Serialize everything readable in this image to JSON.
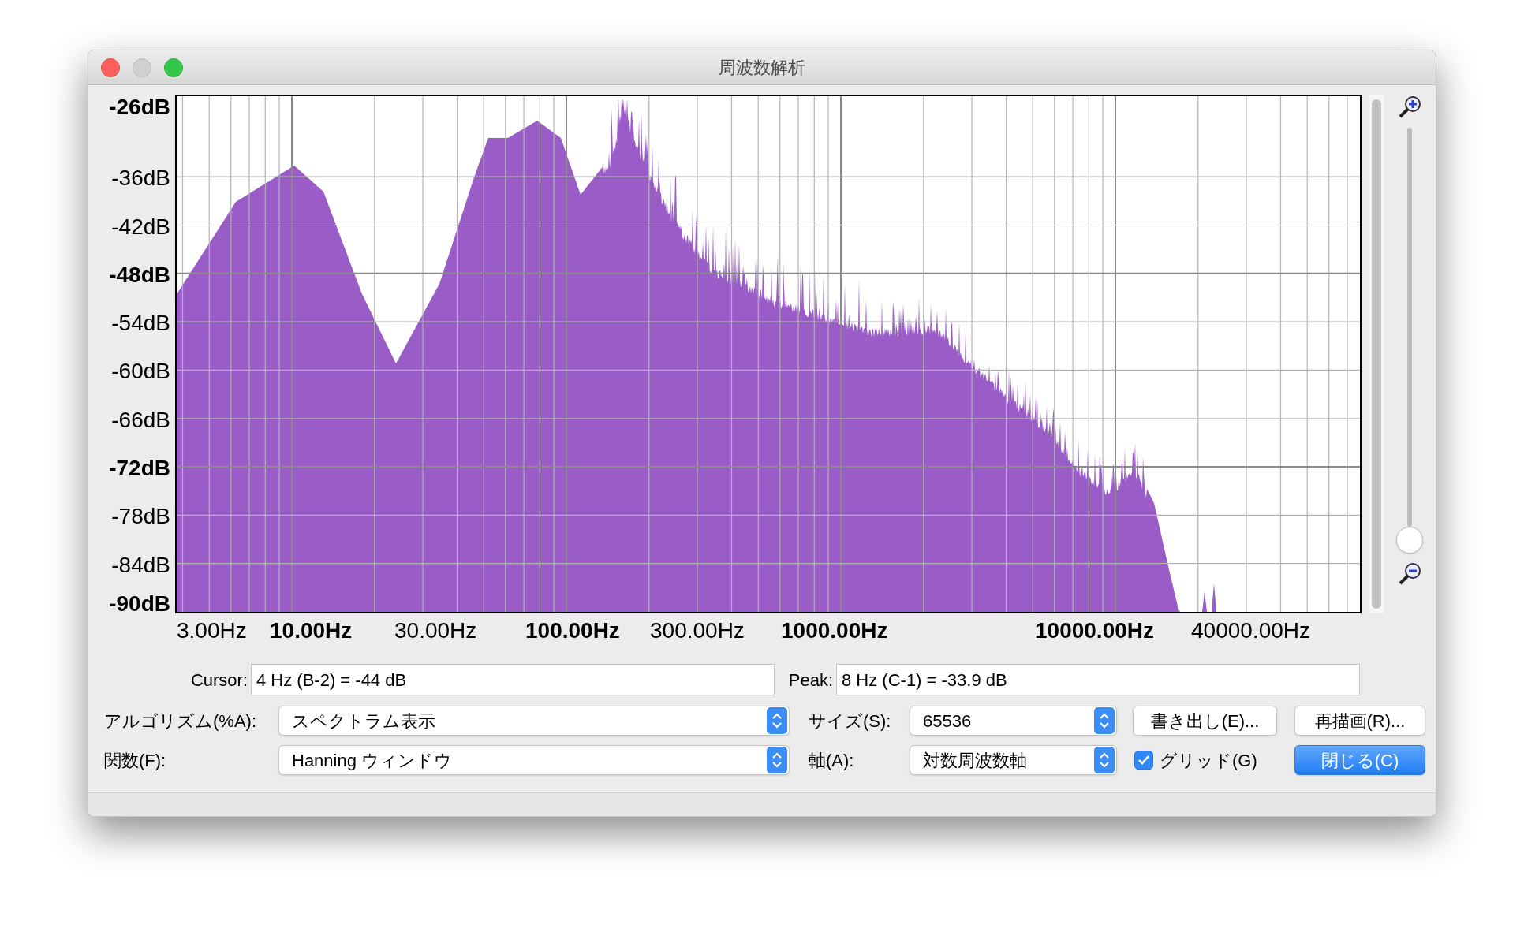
{
  "window": {
    "title": "周波数解析"
  },
  "plot": {
    "y_labels": [
      {
        "text": "-26dB",
        "major": true
      },
      {
        "text": "-36dB",
        "major": false
      },
      {
        "text": "-42dB",
        "major": false
      },
      {
        "text": "-48dB",
        "major": true
      },
      {
        "text": "-54dB",
        "major": false
      },
      {
        "text": "-60dB",
        "major": false
      },
      {
        "text": "-66dB",
        "major": false
      },
      {
        "text": "-72dB",
        "major": true
      },
      {
        "text": "-78dB",
        "major": false
      },
      {
        "text": "-84dB",
        "major": false
      },
      {
        "text": "-90dB",
        "major": true
      }
    ],
    "x_labels": [
      {
        "text": "3.00Hz",
        "major": false
      },
      {
        "text": "10.00Hz",
        "major": true
      },
      {
        "text": "30.00Hz",
        "major": false
      },
      {
        "text": "100.00Hz",
        "major": true
      },
      {
        "text": "300.00Hz",
        "major": false
      },
      {
        "text": "1000.00Hz",
        "major": true
      },
      {
        "text": "10000.00Hz",
        "major": true
      },
      {
        "text": "40000.00Hz",
        "major": false
      }
    ]
  },
  "zoom_slider": {
    "level": 0
  },
  "cursor": {
    "label": "Cursor:",
    "value": "4 Hz (B-2) = -44 dB"
  },
  "peak": {
    "label": "Peak:",
    "value": "8 Hz (C-1) = -33.9 dB"
  },
  "algorithm": {
    "label": "アルゴリズム(%A):",
    "value": "スペクトラム表示"
  },
  "size": {
    "label": "サイズ(S):",
    "value": "65536"
  },
  "function": {
    "label": "関数(F):",
    "value": "Hanning ウィンドウ"
  },
  "axis": {
    "label": "軸(A):",
    "value": "対数周波数軸"
  },
  "buttons": [
    {
      "label": "書き出し(E)...",
      "default": false
    },
    {
      "label": "再描画(R)...",
      "default": false
    },
    {
      "label": "閉じる(C)",
      "default": true
    }
  ],
  "grid_checkbox": {
    "label": "グリッド(G)",
    "checked": true
  }
}
